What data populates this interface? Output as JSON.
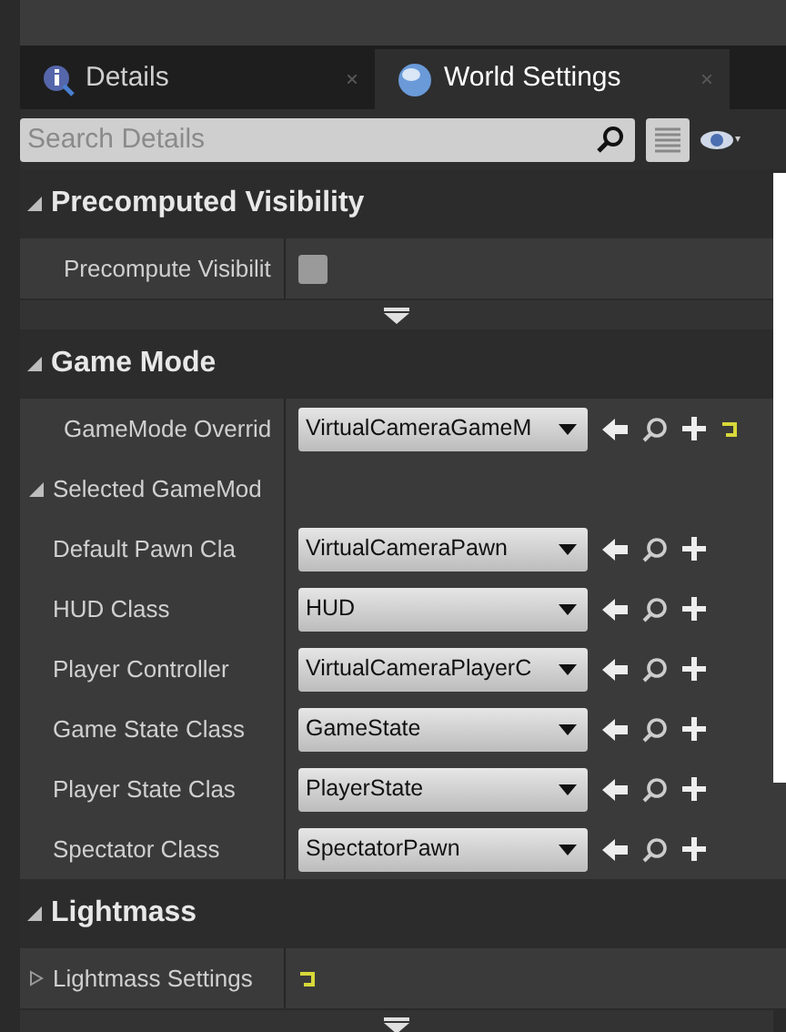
{
  "tabs": [
    {
      "label": "Details",
      "selected": false,
      "kind": "info"
    },
    {
      "label": "World Settings",
      "selected": true,
      "kind": "globe"
    }
  ],
  "search": {
    "placeholder": "Search Details"
  },
  "sections": [
    {
      "title": "Precomputed Visibility",
      "expanded": true,
      "advanced": true,
      "rows": [
        {
          "kind": "checkbox",
          "label": "Precompute Visibilit",
          "checked": false
        }
      ]
    },
    {
      "title": "Game Mode",
      "expanded": true,
      "advanced": false,
      "rows": [
        {
          "kind": "class",
          "label": "GameMode Overrid",
          "value": "VirtualCameraGameM",
          "reset": true
        },
        {
          "kind": "group",
          "label": "Selected GameMod",
          "expanded": true,
          "children": [
            {
              "kind": "class",
              "label": "Default Pawn Cla",
              "value": "VirtualCameraPawn",
              "reset": false
            },
            {
              "kind": "class",
              "label": "HUD Class",
              "value": "HUD",
              "reset": false
            },
            {
              "kind": "class",
              "label": "Player Controller",
              "value": "VirtualCameraPlayerC",
              "reset": false
            },
            {
              "kind": "class",
              "label": "Game State Class",
              "value": "GameState",
              "reset": false
            },
            {
              "kind": "class",
              "label": "Player State Clas",
              "value": "PlayerState",
              "reset": false
            },
            {
              "kind": "class",
              "label": "Spectator Class",
              "value": "SpectatorPawn",
              "reset": false
            }
          ]
        }
      ]
    },
    {
      "title": "Lightmass",
      "expanded": true,
      "advanced": true,
      "rows": [
        {
          "kind": "struct",
          "label": "Lightmass Settings",
          "expanded": false,
          "reset": true
        }
      ]
    }
  ]
}
